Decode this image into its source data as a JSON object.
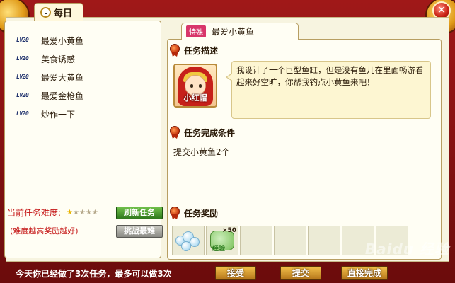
{
  "daily_tab": "每日",
  "tasks": [
    {
      "level": "LV20",
      "name": "最爱小黄鱼"
    },
    {
      "level": "LV20",
      "name": "美食诱惑"
    },
    {
      "level": "LV20",
      "name": "最爱大黄鱼"
    },
    {
      "level": "LV20",
      "name": "最爱金枪鱼"
    },
    {
      "level": "LV20",
      "name": "炒作一下"
    }
  ],
  "difficulty": {
    "label": "当前任务难度:",
    "stars_total": 5,
    "stars_on": 1,
    "note": "(难度越高奖励越好)"
  },
  "buttons": {
    "refresh": "刷新任务",
    "challenge": "挑战最难",
    "accept": "接受",
    "submit": "提交",
    "complete": "直接完成"
  },
  "detail": {
    "tag": "特殊",
    "title": "最爱小黄鱼",
    "desc_head": "任务描述",
    "npc_name": "小红帽",
    "desc_text": "我设计了一个巨型鱼缸，但是没有鱼儿在里面畅游看起来好空旷，你帮我钓点小黄鱼来吧！",
    "cond_head": "任务完成条件",
    "cond_text": "提交小黄鱼2个",
    "reward_head": "任务奖励",
    "rewards": [
      {
        "icon": "bubbles-item-icon",
        "count": ""
      },
      {
        "icon": "exp-item-icon",
        "label": "经验",
        "count": "×50"
      }
    ]
  },
  "bottom_text": "今天你已经做了3次任务，最多可以做3次",
  "watermark": "Baidu 经验",
  "colors": {
    "accent_red": "#c41212",
    "frame": "#7d1010",
    "panel": "#fffef4"
  }
}
